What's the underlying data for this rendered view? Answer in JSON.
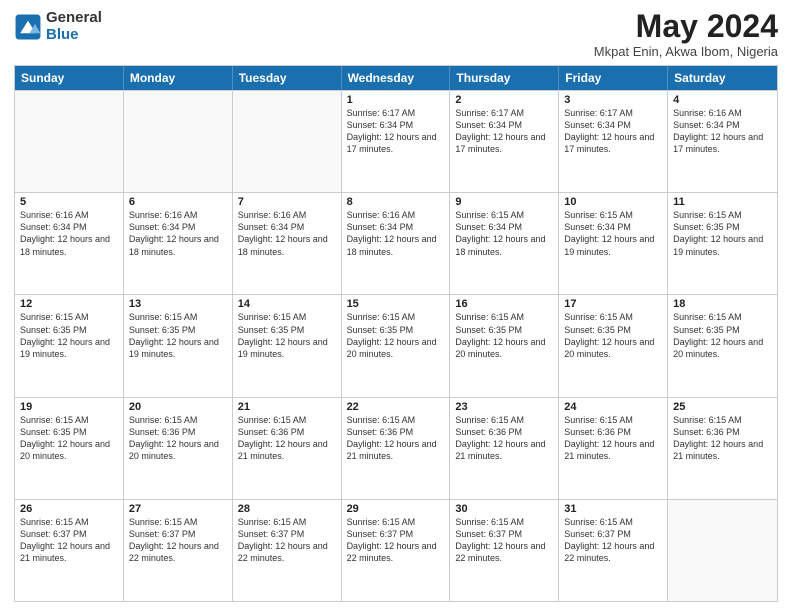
{
  "logo": {
    "general": "General",
    "blue": "Blue"
  },
  "header": {
    "month": "May 2024",
    "location": "Mkpat Enin, Akwa Ibom, Nigeria"
  },
  "weekdays": [
    "Sunday",
    "Monday",
    "Tuesday",
    "Wednesday",
    "Thursday",
    "Friday",
    "Saturday"
  ],
  "rows": [
    [
      {
        "day": "",
        "info": ""
      },
      {
        "day": "",
        "info": ""
      },
      {
        "day": "",
        "info": ""
      },
      {
        "day": "1",
        "info": "Sunrise: 6:17 AM\nSunset: 6:34 PM\nDaylight: 12 hours and 17 minutes."
      },
      {
        "day": "2",
        "info": "Sunrise: 6:17 AM\nSunset: 6:34 PM\nDaylight: 12 hours and 17 minutes."
      },
      {
        "day": "3",
        "info": "Sunrise: 6:17 AM\nSunset: 6:34 PM\nDaylight: 12 hours and 17 minutes."
      },
      {
        "day": "4",
        "info": "Sunrise: 6:16 AM\nSunset: 6:34 PM\nDaylight: 12 hours and 17 minutes."
      }
    ],
    [
      {
        "day": "5",
        "info": "Sunrise: 6:16 AM\nSunset: 6:34 PM\nDaylight: 12 hours and 18 minutes."
      },
      {
        "day": "6",
        "info": "Sunrise: 6:16 AM\nSunset: 6:34 PM\nDaylight: 12 hours and 18 minutes."
      },
      {
        "day": "7",
        "info": "Sunrise: 6:16 AM\nSunset: 6:34 PM\nDaylight: 12 hours and 18 minutes."
      },
      {
        "day": "8",
        "info": "Sunrise: 6:16 AM\nSunset: 6:34 PM\nDaylight: 12 hours and 18 minutes."
      },
      {
        "day": "9",
        "info": "Sunrise: 6:15 AM\nSunset: 6:34 PM\nDaylight: 12 hours and 18 minutes."
      },
      {
        "day": "10",
        "info": "Sunrise: 6:15 AM\nSunset: 6:34 PM\nDaylight: 12 hours and 19 minutes."
      },
      {
        "day": "11",
        "info": "Sunrise: 6:15 AM\nSunset: 6:35 PM\nDaylight: 12 hours and 19 minutes."
      }
    ],
    [
      {
        "day": "12",
        "info": "Sunrise: 6:15 AM\nSunset: 6:35 PM\nDaylight: 12 hours and 19 minutes."
      },
      {
        "day": "13",
        "info": "Sunrise: 6:15 AM\nSunset: 6:35 PM\nDaylight: 12 hours and 19 minutes."
      },
      {
        "day": "14",
        "info": "Sunrise: 6:15 AM\nSunset: 6:35 PM\nDaylight: 12 hours and 19 minutes."
      },
      {
        "day": "15",
        "info": "Sunrise: 6:15 AM\nSunset: 6:35 PM\nDaylight: 12 hours and 20 minutes."
      },
      {
        "day": "16",
        "info": "Sunrise: 6:15 AM\nSunset: 6:35 PM\nDaylight: 12 hours and 20 minutes."
      },
      {
        "day": "17",
        "info": "Sunrise: 6:15 AM\nSunset: 6:35 PM\nDaylight: 12 hours and 20 minutes."
      },
      {
        "day": "18",
        "info": "Sunrise: 6:15 AM\nSunset: 6:35 PM\nDaylight: 12 hours and 20 minutes."
      }
    ],
    [
      {
        "day": "19",
        "info": "Sunrise: 6:15 AM\nSunset: 6:35 PM\nDaylight: 12 hours and 20 minutes."
      },
      {
        "day": "20",
        "info": "Sunrise: 6:15 AM\nSunset: 6:36 PM\nDaylight: 12 hours and 20 minutes."
      },
      {
        "day": "21",
        "info": "Sunrise: 6:15 AM\nSunset: 6:36 PM\nDaylight: 12 hours and 21 minutes."
      },
      {
        "day": "22",
        "info": "Sunrise: 6:15 AM\nSunset: 6:36 PM\nDaylight: 12 hours and 21 minutes."
      },
      {
        "day": "23",
        "info": "Sunrise: 6:15 AM\nSunset: 6:36 PM\nDaylight: 12 hours and 21 minutes."
      },
      {
        "day": "24",
        "info": "Sunrise: 6:15 AM\nSunset: 6:36 PM\nDaylight: 12 hours and 21 minutes."
      },
      {
        "day": "25",
        "info": "Sunrise: 6:15 AM\nSunset: 6:36 PM\nDaylight: 12 hours and 21 minutes."
      }
    ],
    [
      {
        "day": "26",
        "info": "Sunrise: 6:15 AM\nSunset: 6:37 PM\nDaylight: 12 hours and 21 minutes."
      },
      {
        "day": "27",
        "info": "Sunrise: 6:15 AM\nSunset: 6:37 PM\nDaylight: 12 hours and 22 minutes."
      },
      {
        "day": "28",
        "info": "Sunrise: 6:15 AM\nSunset: 6:37 PM\nDaylight: 12 hours and 22 minutes."
      },
      {
        "day": "29",
        "info": "Sunrise: 6:15 AM\nSunset: 6:37 PM\nDaylight: 12 hours and 22 minutes."
      },
      {
        "day": "30",
        "info": "Sunrise: 6:15 AM\nSunset: 6:37 PM\nDaylight: 12 hours and 22 minutes."
      },
      {
        "day": "31",
        "info": "Sunrise: 6:15 AM\nSunset: 6:37 PM\nDaylight: 12 hours and 22 minutes."
      },
      {
        "day": "",
        "info": ""
      }
    ]
  ]
}
